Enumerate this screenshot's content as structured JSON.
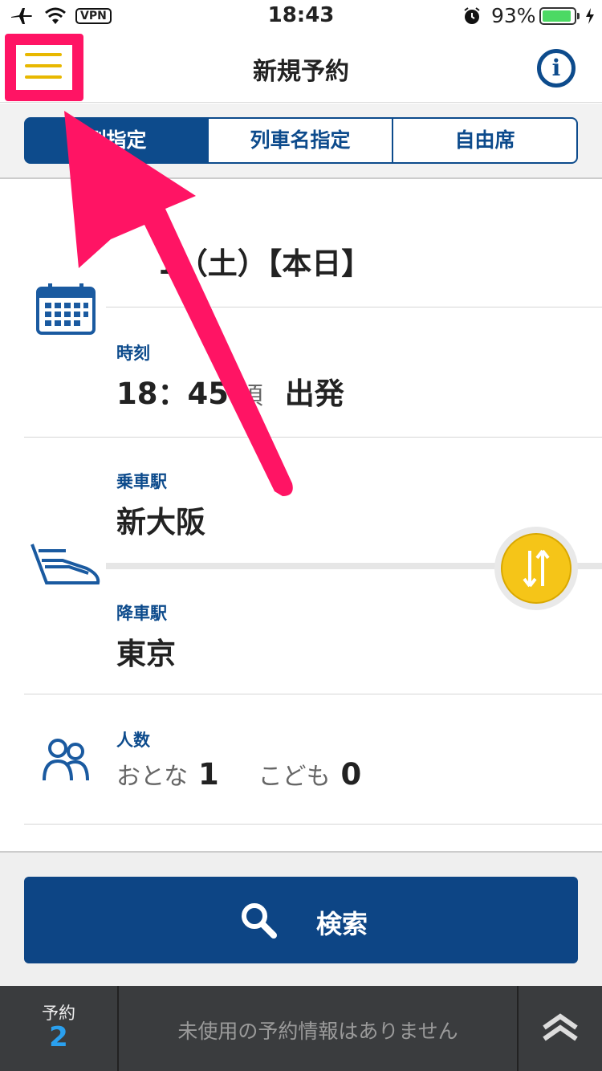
{
  "status_bar": {
    "vpn": "VPN",
    "time": "18:43",
    "battery_percent": "93%",
    "battery_level": 0.93,
    "icons": [
      "airplane-icon",
      "wifi-icon",
      "alarm-icon",
      "battery-icon",
      "charging-icon"
    ]
  },
  "header": {
    "title": "新規予約",
    "menu_icon": "hamburger-menu-icon",
    "info_icon": "info-icon",
    "info_glyph": "i"
  },
  "tabs": [
    {
      "label": "列指定",
      "visible_label": "列指定",
      "active": true
    },
    {
      "label": "列車名指定",
      "active": false
    },
    {
      "label": "自由席",
      "active": false
    }
  ],
  "form": {
    "date": {
      "label": "日",
      "value": "1（土）【本日】",
      "icon": "calendar-icon"
    },
    "time": {
      "label": "時刻",
      "value": "18：45",
      "suffix_approx": "頃",
      "suffix_depart": "出発"
    },
    "departure": {
      "label": "乗車駅",
      "value": "新大阪",
      "icon": "train-icon"
    },
    "arrival": {
      "label": "降車駅",
      "value": "東京"
    },
    "swap_icon": "swap-arrows-icon",
    "passengers": {
      "label": "人数",
      "adult_label": "おとな",
      "adult_count": "1",
      "child_label": "こども",
      "child_count": "0",
      "icon": "people-icon"
    }
  },
  "search": {
    "label": "検索",
    "icon": "search-icon"
  },
  "bottom_bar": {
    "reservation_label": "予約",
    "reservation_count": "2",
    "message": "未使用の予約情報はありません",
    "expand_icon": "double-chevron-up-icon"
  },
  "colors": {
    "brand_blue": "#0d4b8c",
    "accent_yellow": "#f5c518",
    "annotation_pink": "#ff1464",
    "bottom_bar": "#3a3c3e",
    "count_blue": "#2aa0ef"
  }
}
